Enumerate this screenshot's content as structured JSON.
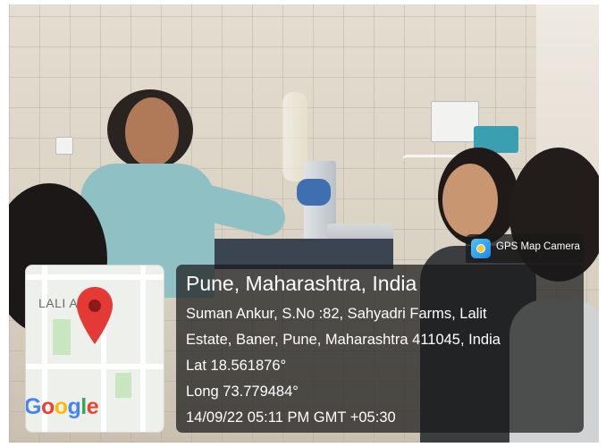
{
  "photo": {
    "description_icon": "lab-photo"
  },
  "camera_badge": {
    "label": "GPS Map Camera",
    "icon": "camera-app-icon"
  },
  "map": {
    "estate_label": "LALIT ESTATE",
    "estate_label_visible": "LALI  ATE",
    "brand": "Google",
    "brand_colors": [
      "#4285F4",
      "#EA4335",
      "#FBBC05",
      "#4285F4",
      "#34A853",
      "#EA4335"
    ],
    "pin_color": "#E53935"
  },
  "location": {
    "title": "Pune, Maharashtra, India",
    "address_line1": "Suman Ankur, S.No :82, Sahyadri Farms, Lalit",
    "address_line2": "Estate, Baner, Pune, Maharashtra 411045, India",
    "lat": "Lat 18.561876°",
    "long": "Long 73.779484°",
    "timestamp": "14/09/22 05:11 PM GMT +05:30"
  }
}
